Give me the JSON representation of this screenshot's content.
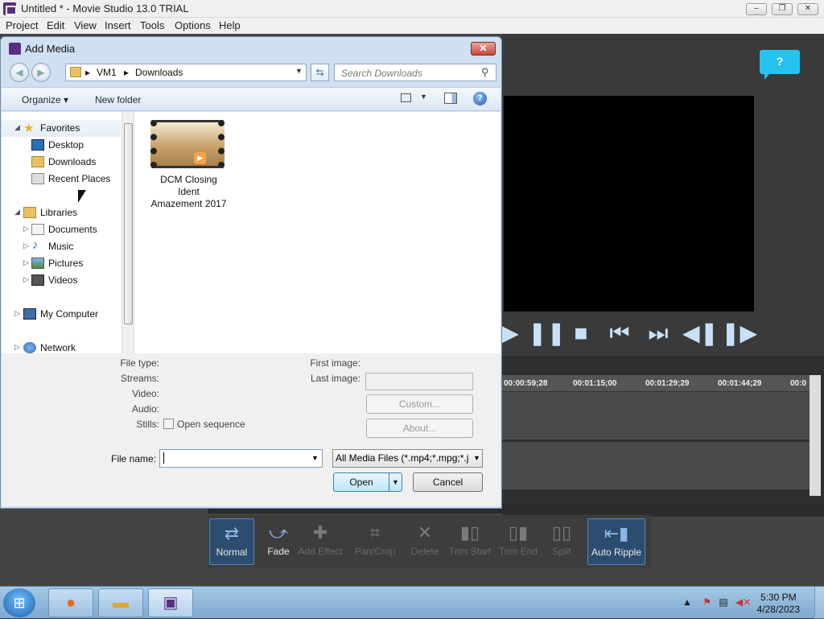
{
  "app": {
    "title": "Untitled * - Movie Studio 13.0 TRIAL",
    "window_buttons": [
      "–",
      "❐",
      "✕"
    ],
    "menu": [
      "Project",
      "Edit",
      "View",
      "Insert",
      "Tools",
      "Options",
      "Help"
    ]
  },
  "help_bubble": "?",
  "transport_icons": [
    "play-icon",
    "pause-icon",
    "stop-icon",
    "prev-frame-icon",
    "next-frame-icon",
    "rewind-icon",
    "fast-forward-icon"
  ],
  "timeline": {
    "ticks": [
      "00:00:59;28",
      "00:01:15;00",
      "00:01:29;29",
      "00:01:44;29",
      "00:0"
    ]
  },
  "tools": [
    {
      "label": "Normal",
      "enabled": true,
      "active": true
    },
    {
      "label": "Fade",
      "enabled": true,
      "active": false
    },
    {
      "label": "Add Effect",
      "enabled": false,
      "active": false
    },
    {
      "label": "Pan/Crop",
      "enabled": false,
      "active": false
    },
    {
      "label": "Delete",
      "enabled": false,
      "active": false
    },
    {
      "label": "Trim Start",
      "enabled": false,
      "active": false
    },
    {
      "label": "Trim End",
      "enabled": false,
      "active": false
    },
    {
      "label": "Split",
      "enabled": false,
      "active": false
    },
    {
      "label": "Auto Ripple",
      "enabled": true,
      "active": true
    }
  ],
  "dialog": {
    "title": "Add Media",
    "breadcrumb": [
      "VM1",
      "Downloads"
    ],
    "search_placeholder": "Search Downloads",
    "organize_label": "Organize ▾",
    "new_folder_label": "New folder",
    "nav": {
      "favorites": "Favorites",
      "desktop": "Desktop",
      "downloads": "Downloads",
      "recent": "Recent Places",
      "libraries": "Libraries",
      "documents": "Documents",
      "music": "Music",
      "pictures": "Pictures",
      "videos": "Videos",
      "computer": "My Computer",
      "network": "Network"
    },
    "file": {
      "name_line1": "DCM Closing",
      "name_line2": "Ident",
      "name_line3": "Amazement 2017"
    },
    "details": {
      "file_type": "File type:",
      "streams": "Streams:",
      "video": "Video:",
      "audio": "Audio:",
      "stills": "Stills:",
      "open_sequence": "Open sequence",
      "first_image": "First image:",
      "last_image": "Last image:",
      "custom": "Custom...",
      "about": "About..."
    },
    "file_name_label": "File name:",
    "file_name_value": "",
    "file_type_filter": "All Media Files (*.mp4;*.mpg;*.j",
    "open_label": "Open",
    "cancel_label": "Cancel"
  },
  "taskbar": {
    "time": "5:30 PM",
    "date": "4/28/2023"
  },
  "colors": {
    "accent": "#25c3ef",
    "app_bg": "#3d3d3d",
    "dialog_frame": "#cfe0f1"
  }
}
